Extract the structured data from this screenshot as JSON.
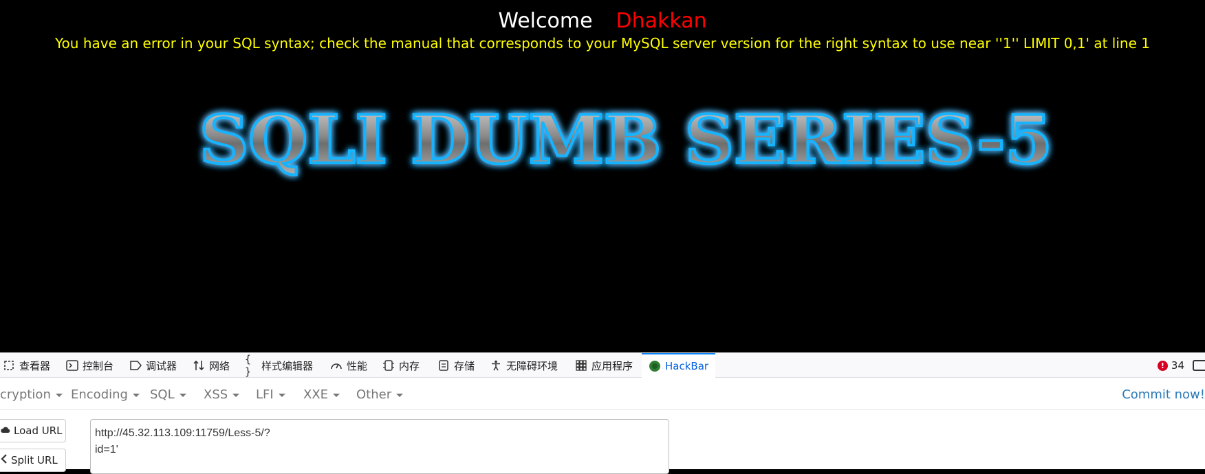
{
  "page": {
    "welcome": "Welcome",
    "username": "Dhakkan",
    "error": "You have an error in your SQL syntax; check the manual that corresponds to your MySQL server version for the right syntax to use near ''1'' LIMIT 0,1' at line 1",
    "title_image_text": "SQLI DUMB SERIES-5"
  },
  "devtools": {
    "tabs": [
      {
        "label": "查看器",
        "icon": "inspector-icon"
      },
      {
        "label": "控制台",
        "icon": "console-icon"
      },
      {
        "label": "调试器",
        "icon": "debugger-icon"
      },
      {
        "label": "网络",
        "icon": "network-icon"
      },
      {
        "label": "样式编辑器",
        "icon": "style-editor-icon"
      },
      {
        "label": "性能",
        "icon": "performance-icon"
      },
      {
        "label": "内存",
        "icon": "memory-icon"
      },
      {
        "label": "存储",
        "icon": "storage-icon"
      },
      {
        "label": "无障碍环境",
        "icon": "accessibility-icon"
      },
      {
        "label": "应用程序",
        "icon": "application-icon"
      },
      {
        "label": "HackBar",
        "icon": "hackbar-icon"
      }
    ],
    "error_count": "34"
  },
  "hackbar": {
    "menu": [
      "cryption",
      "Encoding",
      "SQL",
      "XSS",
      "LFI",
      "XXE",
      "Other"
    ],
    "commit": "Commit now!",
    "load_url": "Load URL",
    "split_url": "Split URL",
    "url_value": "http://45.32.113.109:11759/Less-5/?\nid=1'"
  },
  "colors": {
    "welcome": "#ffffff",
    "username": "#ff0000",
    "error": "#ffff00",
    "title_glow": "#0aa0ff",
    "active_tab": "#0060df",
    "commit_link": "#2a7ab8"
  }
}
